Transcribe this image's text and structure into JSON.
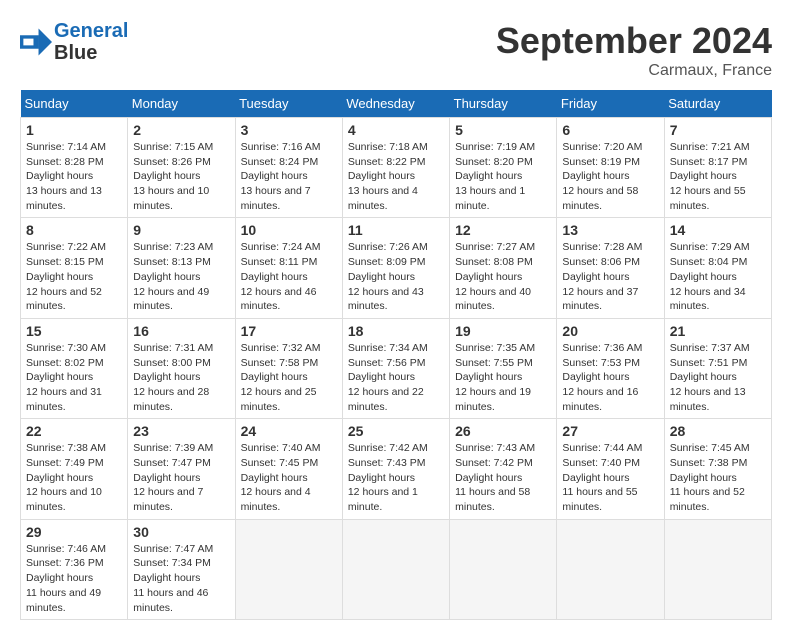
{
  "header": {
    "logo_line1": "General",
    "logo_line2": "Blue",
    "month_title": "September 2024",
    "location": "Carmaux, France"
  },
  "calendar": {
    "days_of_week": [
      "Sunday",
      "Monday",
      "Tuesday",
      "Wednesday",
      "Thursday",
      "Friday",
      "Saturday"
    ],
    "weeks": [
      [
        null,
        {
          "day": "2",
          "sunrise": "7:15 AM",
          "sunset": "8:26 PM",
          "daylight": "13 hours and 10 minutes."
        },
        {
          "day": "3",
          "sunrise": "7:16 AM",
          "sunset": "8:24 PM",
          "daylight": "13 hours and 7 minutes."
        },
        {
          "day": "4",
          "sunrise": "7:18 AM",
          "sunset": "8:22 PM",
          "daylight": "13 hours and 4 minutes."
        },
        {
          "day": "5",
          "sunrise": "7:19 AM",
          "sunset": "8:20 PM",
          "daylight": "13 hours and 1 minute."
        },
        {
          "day": "6",
          "sunrise": "7:20 AM",
          "sunset": "8:19 PM",
          "daylight": "12 hours and 58 minutes."
        },
        {
          "day": "7",
          "sunrise": "7:21 AM",
          "sunset": "8:17 PM",
          "daylight": "12 hours and 55 minutes."
        }
      ],
      [
        {
          "day": "1",
          "sunrise": "7:14 AM",
          "sunset": "8:28 PM",
          "daylight": "13 hours and 13 minutes."
        },
        {
          "day": "8",
          "sunrise": "7:22 AM",
          "sunset": "8:15 PM",
          "daylight": "12 hours and 52 minutes."
        },
        {
          "day": "9",
          "sunrise": "7:23 AM",
          "sunset": "8:13 PM",
          "daylight": "12 hours and 49 minutes."
        },
        {
          "day": "10",
          "sunrise": "7:24 AM",
          "sunset": "8:11 PM",
          "daylight": "12 hours and 46 minutes."
        },
        {
          "day": "11",
          "sunrise": "7:26 AM",
          "sunset": "8:09 PM",
          "daylight": "12 hours and 43 minutes."
        },
        {
          "day": "12",
          "sunrise": "7:27 AM",
          "sunset": "8:08 PM",
          "daylight": "12 hours and 40 minutes."
        },
        {
          "day": "13",
          "sunrise": "7:28 AM",
          "sunset": "8:06 PM",
          "daylight": "12 hours and 37 minutes."
        },
        {
          "day": "14",
          "sunrise": "7:29 AM",
          "sunset": "8:04 PM",
          "daylight": "12 hours and 34 minutes."
        }
      ],
      [
        {
          "day": "15",
          "sunrise": "7:30 AM",
          "sunset": "8:02 PM",
          "daylight": "12 hours and 31 minutes."
        },
        {
          "day": "16",
          "sunrise": "7:31 AM",
          "sunset": "8:00 PM",
          "daylight": "12 hours and 28 minutes."
        },
        {
          "day": "17",
          "sunrise": "7:32 AM",
          "sunset": "7:58 PM",
          "daylight": "12 hours and 25 minutes."
        },
        {
          "day": "18",
          "sunrise": "7:34 AM",
          "sunset": "7:56 PM",
          "daylight": "12 hours and 22 minutes."
        },
        {
          "day": "19",
          "sunrise": "7:35 AM",
          "sunset": "7:55 PM",
          "daylight": "12 hours and 19 minutes."
        },
        {
          "day": "20",
          "sunrise": "7:36 AM",
          "sunset": "7:53 PM",
          "daylight": "12 hours and 16 minutes."
        },
        {
          "day": "21",
          "sunrise": "7:37 AM",
          "sunset": "7:51 PM",
          "daylight": "12 hours and 13 minutes."
        }
      ],
      [
        {
          "day": "22",
          "sunrise": "7:38 AM",
          "sunset": "7:49 PM",
          "daylight": "12 hours and 10 minutes."
        },
        {
          "day": "23",
          "sunrise": "7:39 AM",
          "sunset": "7:47 PM",
          "daylight": "12 hours and 7 minutes."
        },
        {
          "day": "24",
          "sunrise": "7:40 AM",
          "sunset": "7:45 PM",
          "daylight": "12 hours and 4 minutes."
        },
        {
          "day": "25",
          "sunrise": "7:42 AM",
          "sunset": "7:43 PM",
          "daylight": "12 hours and 1 minute."
        },
        {
          "day": "26",
          "sunrise": "7:43 AM",
          "sunset": "7:42 PM",
          "daylight": "11 hours and 58 minutes."
        },
        {
          "day": "27",
          "sunrise": "7:44 AM",
          "sunset": "7:40 PM",
          "daylight": "11 hours and 55 minutes."
        },
        {
          "day": "28",
          "sunrise": "7:45 AM",
          "sunset": "7:38 PM",
          "daylight": "11 hours and 52 minutes."
        }
      ],
      [
        {
          "day": "29",
          "sunrise": "7:46 AM",
          "sunset": "7:36 PM",
          "daylight": "11 hours and 49 minutes."
        },
        {
          "day": "30",
          "sunrise": "7:47 AM",
          "sunset": "7:34 PM",
          "daylight": "11 hours and 46 minutes."
        },
        null,
        null,
        null,
        null,
        null
      ]
    ]
  }
}
